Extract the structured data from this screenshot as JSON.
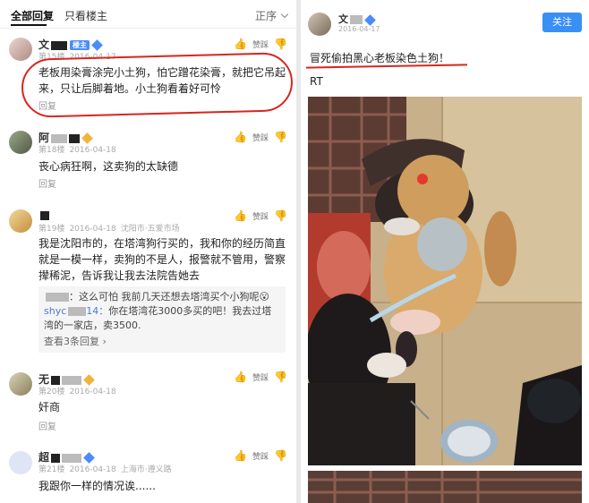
{
  "left": {
    "tabs": {
      "all": "全部回复",
      "op_only": "只看楼主",
      "sort": "正序"
    },
    "actions": {
      "like": "赞踩"
    },
    "comments": [
      {
        "user": "文",
        "badge": "楼主",
        "floor": "第15楼",
        "date": "2016-04-17",
        "text": "老板用染膏涂完小土狗，怕它蹭花染膏，就把它吊起来，只让后脚着地。小土狗看着好可怜",
        "reply_label": "回复"
      },
      {
        "user": "阿",
        "floor": "第18楼",
        "date": "2016-04-18",
        "text": "丧心病狂啊，这卖狗的太缺德",
        "reply_label": "回复"
      },
      {
        "user": "",
        "floor": "第19楼",
        "date": "2016-04-18",
        "location": "沈阳市·五爱市场",
        "text": "我是沈阳市的，在塔湾狗行买的，我和你的经历简直就是一模一样，卖狗的不是人，报警就不管用，警察撵稀泥，告诉我让我去法院告她去",
        "subreplies": [
          {
            "who": "",
            "text": "：这么可怕 我前几天还想去塔湾买个小狗呢😮"
          },
          {
            "who": "shyc",
            "suffix": "14：",
            "text": "你在塔湾花3000多买的吧！我去过塔湾的一家店，卖3500."
          }
        ],
        "more_replies": "查看3条回复 ›"
      },
      {
        "user": "无",
        "floor": "第20楼",
        "date": "2016-04-18",
        "text": "奸商",
        "reply_label": "回复"
      },
      {
        "user": "超",
        "floor": "第21楼",
        "date": "2016-04-18",
        "location": "上海市·遵义路",
        "text": "我跟你一样的情况诶......"
      }
    ]
  },
  "right": {
    "user": "文",
    "date": "2016-04-17",
    "follow_label": "关注",
    "title": "冒死偷拍黑心老板染色土狗！",
    "subtitle": "RT"
  },
  "colors": {
    "accent": "#3a8ff5",
    "annotation": "#d8261f"
  }
}
